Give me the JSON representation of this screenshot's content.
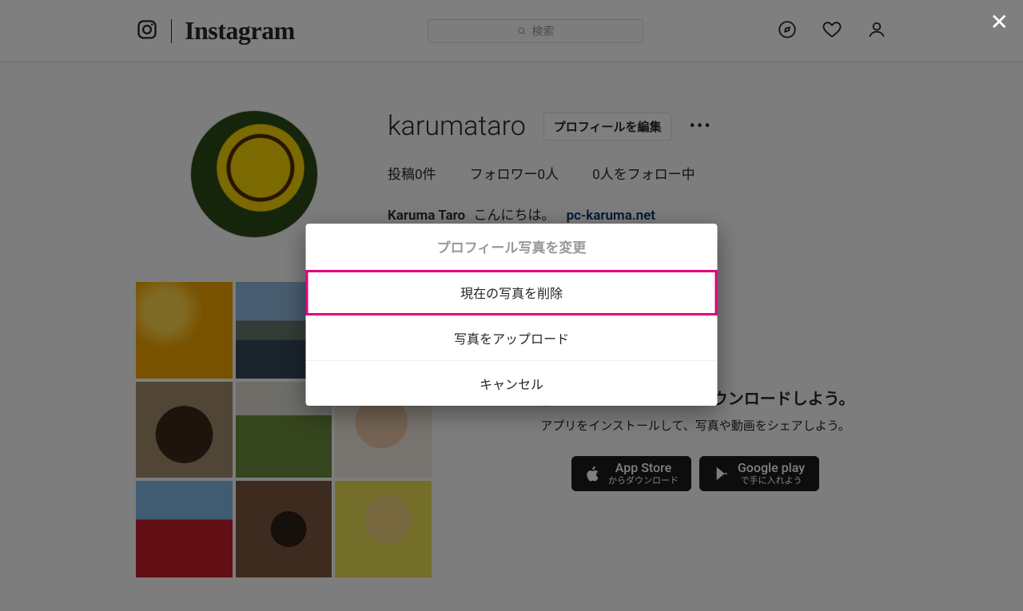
{
  "nav": {
    "brand": "Instagram",
    "search_placeholder": "検索"
  },
  "profile": {
    "username": "karumataro",
    "edit_label": "プロフィールを編集",
    "stats": {
      "posts_label": "投稿0件",
      "followers_label": "フォロワー0人",
      "following_label": "0人をフォロー中"
    },
    "display_name": "Karuma Taro",
    "bio": "こんにちは。",
    "link": "pc-karuma.net"
  },
  "promo": {
    "headline": "撮影したコンテンツをダウンロードしよう。",
    "subline": "アプリをインストールして、写真や動画をシェアしよう。",
    "appstore_top": "App Store",
    "appstore_bottom": "からダウンロード",
    "play_top": "Google play",
    "play_bottom": "で手に入れよう"
  },
  "dialog": {
    "title": "プロフィール写真を変更",
    "opt_remove": "現在の写真を削除",
    "opt_upload": "写真をアップロード",
    "opt_cancel": "キャンセル"
  }
}
